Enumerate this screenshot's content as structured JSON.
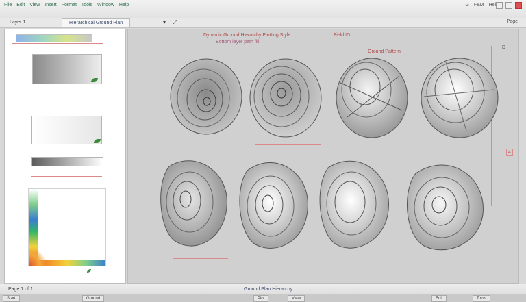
{
  "titlebar": {
    "menu_items": [
      "File",
      "Edit",
      "View",
      "Insert",
      "Format",
      "Tools",
      "Window",
      "Help"
    ],
    "right_labels": [
      "G",
      "F&M",
      "Help"
    ]
  },
  "toolbar": {
    "tab_label": "Hierarchical Ground Plan",
    "left_label": "Layer 1",
    "arrow_icon": "chevron-down-icon",
    "right_label": "Page"
  },
  "canvas": {
    "header_text": "Dynamic Ground Hierarchy Plotting Style",
    "header_sub": "Bottom layer path fill",
    "right_text": "Field ID",
    "right_sub": "Ground Pattern",
    "side_label": "D",
    "marker_label": "4"
  },
  "statusbar": {
    "left_text": "Page 1 of 1",
    "center_text": "Ground Plan Hierarchy",
    "tasks": [
      "Start",
      "Ground",
      "Plot",
      "View",
      "Edit",
      "Tools"
    ]
  },
  "colors": {
    "accent": "#d98a8a",
    "stroke": "#555555"
  }
}
